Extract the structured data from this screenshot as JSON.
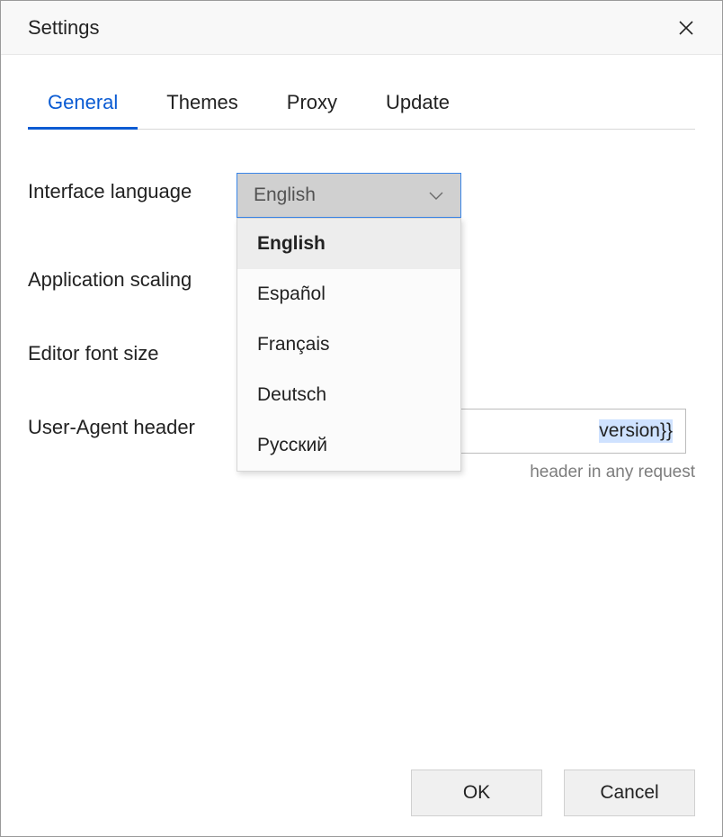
{
  "window": {
    "title": "Settings"
  },
  "tabs": {
    "items": [
      "General",
      "Themes",
      "Proxy",
      "Update"
    ],
    "active_index": 0
  },
  "form": {
    "interface_language": {
      "label": "Interface language",
      "value": "English",
      "options": [
        "English",
        "Español",
        "Français",
        "Deutsch",
        "Русский"
      ]
    },
    "application_scaling": {
      "label": "Application scaling"
    },
    "editor_font_size": {
      "label": "Editor font size"
    },
    "user_agent_header": {
      "label": "User-Agent header",
      "value_visible_suffix": "version}}",
      "hint_visible_suffix": "header in any request"
    }
  },
  "footer": {
    "ok": "OK",
    "cancel": "Cancel"
  }
}
